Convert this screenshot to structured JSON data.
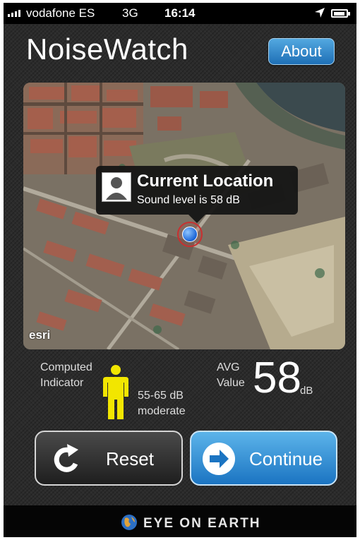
{
  "status_bar": {
    "carrier": "vodafone ES",
    "network": "3G",
    "time": "16:14"
  },
  "header": {
    "title": "NoiseWatch",
    "about_label": "About"
  },
  "map": {
    "attribution": "esri",
    "callout": {
      "title": "Current Location",
      "subtitle": "Sound level is 58 dB"
    }
  },
  "metrics": {
    "indicator_label_line1": "Computed",
    "indicator_label_line2": "Indicator",
    "range": "55-65 dB",
    "level": "moderate",
    "avg_label_line1": "AVG",
    "avg_label_line2": "Value",
    "avg_value": "58",
    "avg_unit": "dB",
    "indicator_color": "#f2e600"
  },
  "actions": {
    "reset_label": "Reset",
    "continue_label": "Continue"
  },
  "footer": {
    "brand": "EYE ON EARTH"
  },
  "icons": [
    "signal-icon",
    "location-arrow-icon",
    "battery-icon",
    "avatar-icon",
    "location-pin-icon",
    "person-icon",
    "reset-icon",
    "arrow-right-icon",
    "globe-icon"
  ]
}
